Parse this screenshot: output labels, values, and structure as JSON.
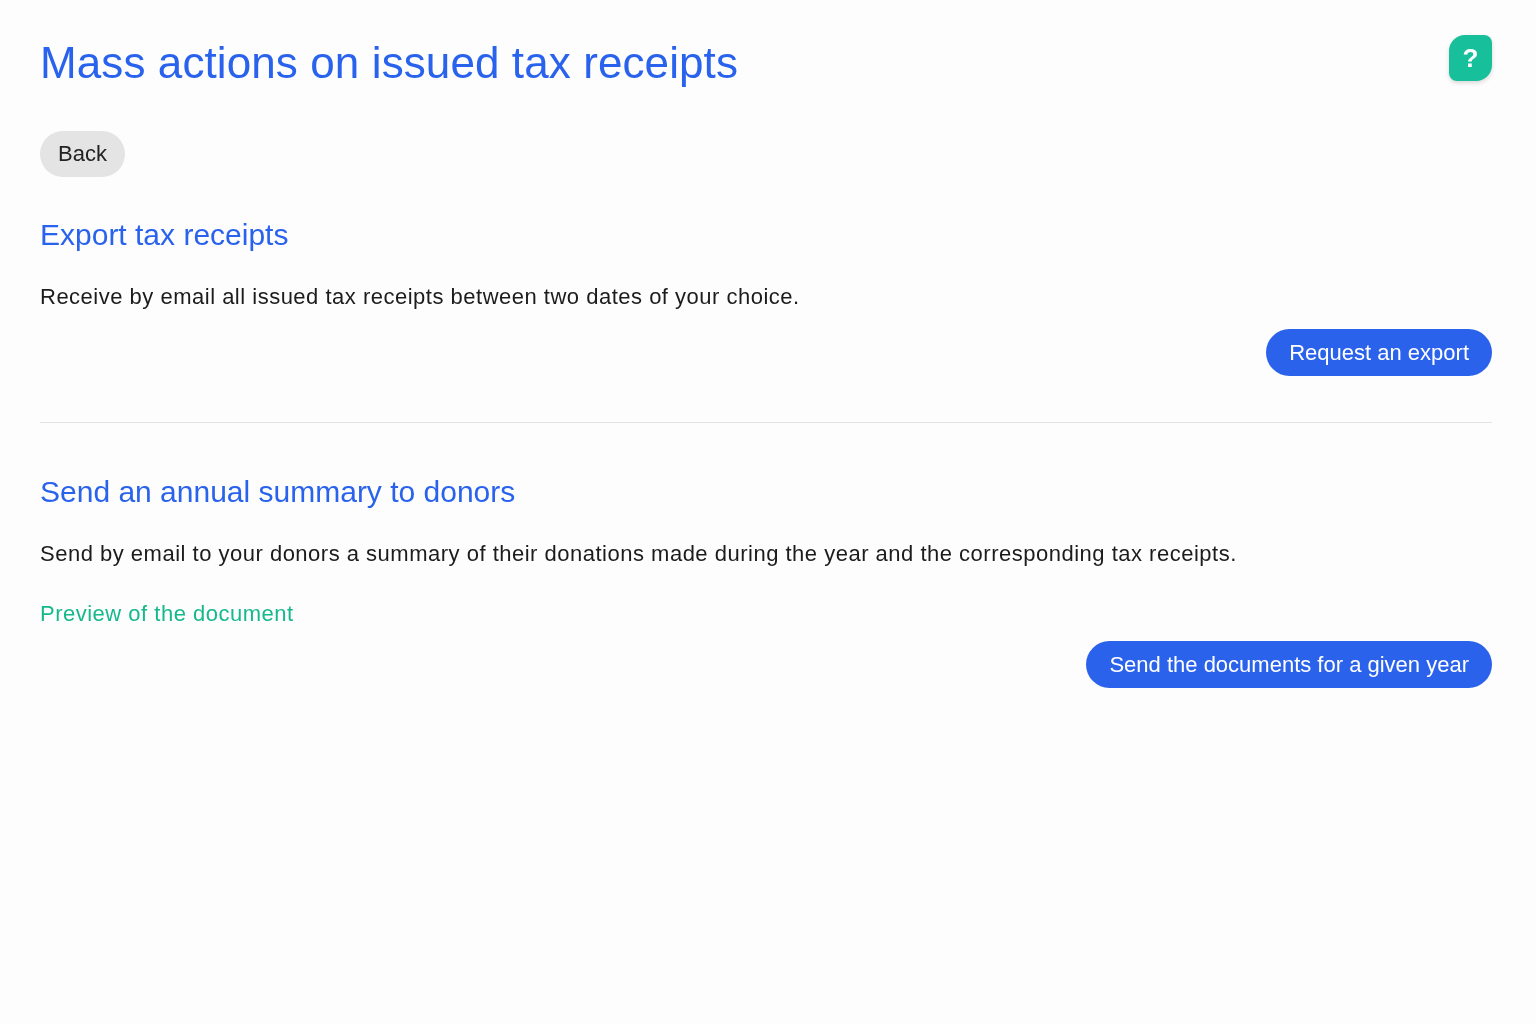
{
  "page": {
    "title": "Mass actions on issued tax receipts",
    "help_button": "?"
  },
  "back_button": "Back",
  "sections": [
    {
      "heading": "Export tax receipts",
      "description": "Receive by email all issued tax receipts between two dates of your choice.",
      "action": "Request an export"
    },
    {
      "heading": "Send an annual summary to donors",
      "description": "Send by email to your donors a summary of their donations made during the year and the corresponding tax receipts.",
      "link": "Preview of the document",
      "action": "Send the documents for a given year"
    }
  ]
}
